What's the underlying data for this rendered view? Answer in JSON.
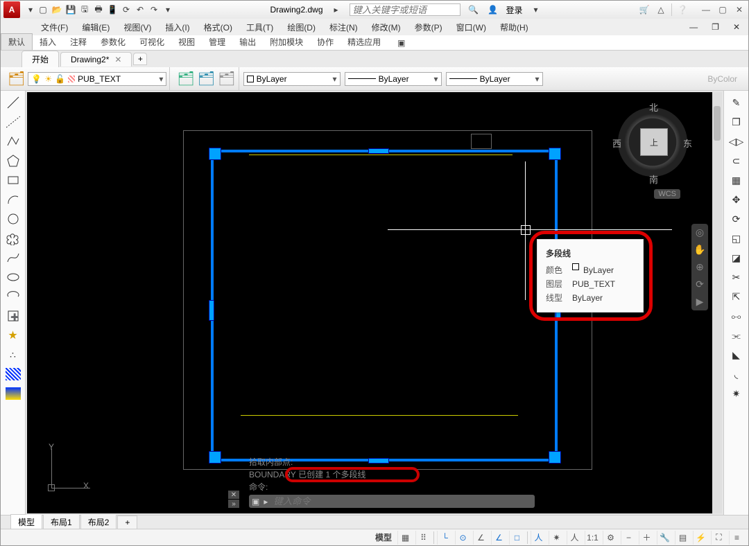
{
  "titlebar": {
    "file_name": "Drawing2.dwg",
    "search_placeholder": "键入关键字或短语",
    "login": "登录"
  },
  "menubar": {
    "items": [
      "文件(F)",
      "编辑(E)",
      "视图(V)",
      "插入(I)",
      "格式(O)",
      "工具(T)",
      "绘图(D)",
      "标注(N)",
      "修改(M)",
      "参数(P)",
      "窗口(W)",
      "帮助(H)"
    ]
  },
  "ribbon": {
    "tabs": [
      "默认",
      "插入",
      "注释",
      "参数化",
      "可视化",
      "视图",
      "管理",
      "输出",
      "附加模块",
      "协作",
      "精选应用"
    ]
  },
  "filetabs": {
    "start": "开始",
    "current": "Drawing2*"
  },
  "props": {
    "layer_name": "PUB_TEXT",
    "color_label": "ByLayer",
    "linetype_label": "ByLayer",
    "lineweight_label": "ByLayer",
    "bycolor": "ByColor"
  },
  "viewcube": {
    "face": "上",
    "n": "北",
    "s": "南",
    "w": "西",
    "e": "东",
    "wcs": "WCS"
  },
  "tooltip": {
    "title": "多段线",
    "rows": [
      {
        "k": "颜色",
        "v": "ByLayer",
        "swatch": true
      },
      {
        "k": "图层",
        "v": "PUB_TEXT"
      },
      {
        "k": "线型",
        "v": "ByLayer"
      }
    ]
  },
  "ucs": {
    "y": "Y",
    "x": "X"
  },
  "command": {
    "line1": "拾取内部点:",
    "line2_pre": "BOUNDARY",
    "line2_mid": "已创建 1 个多段线",
    "line3": "命令:",
    "input_placeholder": "键入命令"
  },
  "layout_tabs": {
    "model": "模型",
    "l1": "布局1",
    "l2": "布局2"
  },
  "status": {
    "model": "模型",
    "scale": "1:1"
  }
}
